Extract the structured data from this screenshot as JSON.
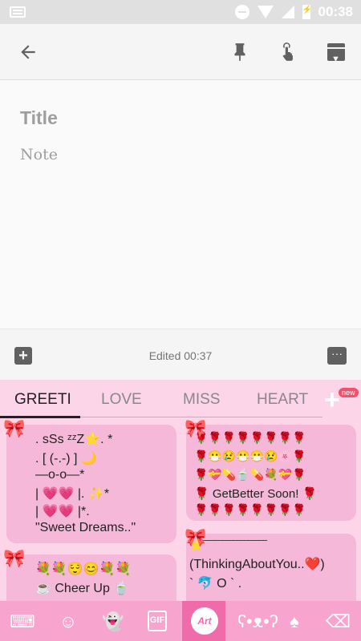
{
  "status_bar": {
    "time": "00:38"
  },
  "note": {
    "title_placeholder": "Title",
    "note_placeholder": "Note",
    "edited": "Edited 00:37"
  },
  "keyboard": {
    "tabs": [
      "GREETI",
      "LOVE",
      "MISS",
      "HEART"
    ],
    "new_badge": "new",
    "cards": {
      "sweet_dreams": {
        "lines": [
          ".    sSs   ᶻᶻZ⭐. *",
          ".  [ (-.-) ]        🌙",
          "—o-o—*",
          "|  💗💗  |.   ✨*",
          "|  💗💗  |*.",
          "\"Sweet Dreams..\""
        ]
      },
      "get_better": {
        "lines": [
          "🌹🌹🌹🌹🌹🌹🌹🌹",
          "🌹😷😢😷😷😢🌸🌹",
          "🌹💝💊🍵💊💐💝🌹",
          "🌹  GetBetter Soon!  🌹",
          "🌹🌹🌹🌹🌹🌹🌹🌹"
        ]
      },
      "cheer_up": {
        "lines": [
          "💐💐😌😊💐💐",
          "☕ Cheer Up 🍵"
        ]
      },
      "thinking": {
        "lines": [
          "⭐‾‾‾‾‾‾‾‾‾‾‾‾‾‾‾‾‾",
          "(ThinkingAboutYou..❤️)",
          "`        🐬   O  `  ."
        ]
      }
    },
    "toolbar": {
      "art_label": "Art"
    }
  }
}
